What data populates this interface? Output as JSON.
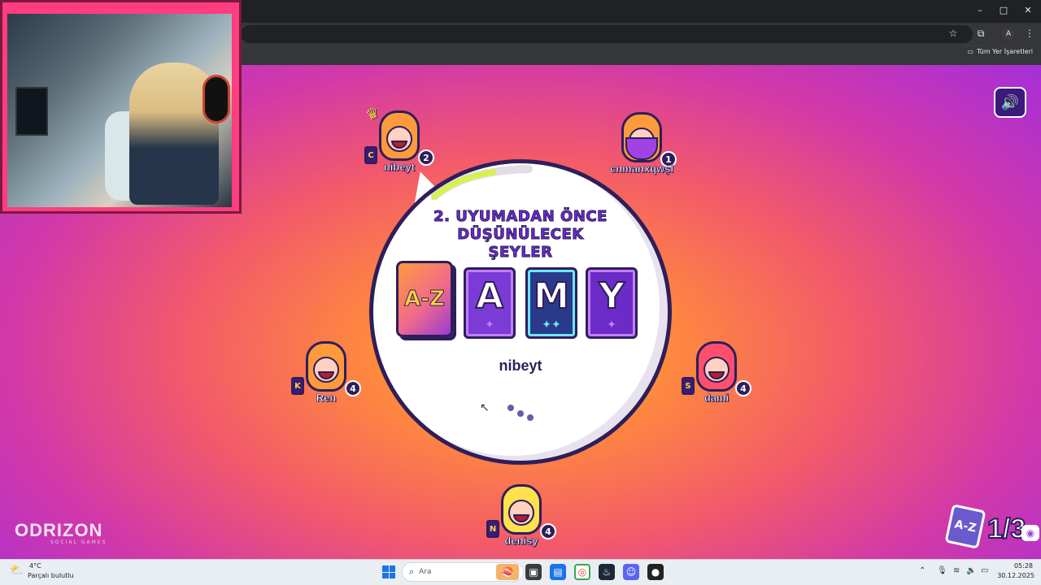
{
  "browser": {
    "window_controls": {
      "minimize": "–",
      "maximize": "□",
      "close": "✕"
    },
    "bookmarks_folder": "Tüm Yer İşaretleri"
  },
  "game": {
    "prompt_line1": "2. UYUMADAN ÖNCE",
    "prompt_line2": "DÜŞÜNÜLECEK ŞEYLER",
    "az_card_label": "A-Z",
    "letters": [
      "A",
      "M",
      "Y"
    ],
    "current_player": "nibeyt",
    "timer_progress": 0.35,
    "round": "1/3",
    "logo": "ODRIZON",
    "logo_sub": "SOCIAL GAMES",
    "players": [
      {
        "name": "nibeyt",
        "score": "2",
        "card": "C",
        "leader": true
      },
      {
        "name": "cnmanxqwşl",
        "score": "1",
        "card": ""
      },
      {
        "name": "Ren",
        "score": "4",
        "card": "K"
      },
      {
        "name": "dami",
        "score": "4",
        "card": "S"
      },
      {
        "name": "denisy",
        "score": "4",
        "card": "N"
      }
    ]
  },
  "taskbar": {
    "weather_temp": "4°C",
    "weather_desc": "Parçalı bulutlu",
    "search_placeholder": "Ara",
    "time": "05:28",
    "date": "30.12.2025"
  },
  "colors": {
    "accent_purple": "#6a2bd3",
    "outline": "#2e1e5a",
    "timer": "#d7f24a"
  }
}
